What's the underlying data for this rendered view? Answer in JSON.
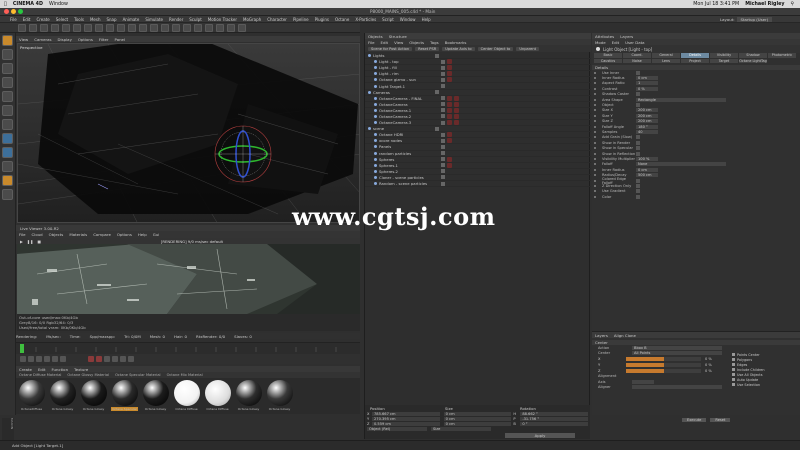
{
  "mac": {
    "app": "CINEMA 4D",
    "menu": "Window",
    "clock": "Mon Jul 18  3:41 PM",
    "user": "Michael Rigley"
  },
  "window": {
    "title": "P8000_MAINS_005.c4d * - Main"
  },
  "menus": [
    "File",
    "Edit",
    "Create",
    "Select",
    "Tools",
    "Mesh",
    "Snap",
    "Animate",
    "Simulate",
    "Render",
    "Sculpt",
    "Motion Tracker",
    "MoGraph",
    "Character",
    "Pipeline",
    "Plugins",
    "Octane",
    "X-Particles",
    "Script",
    "Window",
    "Help"
  ],
  "layout": {
    "label": "Layout:",
    "value": "Startup (User)"
  },
  "viewport": {
    "menu": [
      "View",
      "Cameras",
      "Display",
      "Options",
      "Filter",
      "Panel"
    ],
    "label": "Perspective"
  },
  "liveviewer": {
    "title": "Live Viewer 3.00-R2",
    "menu": [
      "File",
      "Cloud",
      "Objects",
      "Materials",
      "Compare",
      "Options",
      "Help",
      "Gui"
    ],
    "status": "[RENDERING] 9/0 ms/sec default",
    "info1": "Out-of-core used/max:0Kb/4Gb",
    "info2": "Grey8/16: 0/0          Rgb32/64: 0/3",
    "info3": "Used/free/total vram: 0Kb/0Kb/4Gb"
  },
  "render_status": [
    "Rendering:",
    "Ms/sec:",
    "Time:",
    "Spp/maxspp:",
    "Tri: 0/0M",
    "Mesh: 0",
    "Hair: 0",
    "RtxRender: 0/0",
    "Slaves: 0"
  ],
  "materials": {
    "menu": [
      "Create",
      "Edit",
      "Function",
      "Texture"
    ],
    "tabs": [
      "Octane Diffuse Material",
      "Octane Glossy Material",
      "Octane Specular Material",
      "Octane Mix Material"
    ],
    "items": [
      {
        "label": "OctaneDiffuse",
        "fill": "#3a3a3a"
      },
      {
        "label": "Octane Glossy",
        "fill": "#222222"
      },
      {
        "label": "Octane Glossy",
        "fill": "#1a1a1a"
      },
      {
        "label": "Octane Specular",
        "fill": "#2a2a2a"
      },
      {
        "label": "Octane Glossy",
        "fill": "#1c1c1c"
      },
      {
        "label": "Octane Diffuse",
        "fill": "#f2f2f2"
      },
      {
        "label": "Octane Diffuse",
        "fill": "#dddddd"
      },
      {
        "label": "Octane Glossy",
        "fill": "#2e2e2e"
      },
      {
        "label": "Octane Glossy",
        "fill": "#3a3a3a"
      }
    ]
  },
  "object_manager": {
    "tabs": [
      "Objects",
      "Structure"
    ],
    "menu": [
      "File",
      "Edit",
      "View",
      "Objects",
      "Tags",
      "Bookmarks"
    ],
    "buttons": [
      "Scene for Post Action",
      "Reset PSR",
      "Update Axis to",
      "Center Object to",
      "Unparent"
    ],
    "rows": [
      {
        "name": "Lights",
        "sel": false,
        "tags": 0
      },
      {
        "name": "Light - top",
        "sel": false,
        "tags": 1
      },
      {
        "name": "Light - fill",
        "sel": false,
        "tags": 1
      },
      {
        "name": "Light - rim",
        "sel": false,
        "tags": 1
      },
      {
        "name": "Octane gizmo - sun",
        "sel": false,
        "tags": 1
      },
      {
        "name": "Light Target.1",
        "sel": false,
        "tags": 0
      },
      {
        "name": "Cameras",
        "sel": false,
        "tags": 0
      },
      {
        "name": "OctaneCamera - FINAL",
        "sel": false,
        "tags": 2
      },
      {
        "name": "OctaneCamera",
        "sel": false,
        "tags": 2
      },
      {
        "name": "OctaneCamera.1",
        "sel": false,
        "tags": 2
      },
      {
        "name": "OctaneCamera.2",
        "sel": false,
        "tags": 2
      },
      {
        "name": "OctaneCamera.3",
        "sel": false,
        "tags": 2
      },
      {
        "name": "scene",
        "sel": false,
        "tags": 0
      },
      {
        "name": "Octane HDRI",
        "sel": false,
        "tags": 1
      },
      {
        "name": "xcore nodes",
        "sel": false,
        "tags": 1
      },
      {
        "name": "Panels",
        "sel": false,
        "tags": 0
      },
      {
        "name": "random particles",
        "sel": false,
        "tags": 0
      },
      {
        "name": "Spheres",
        "sel": false,
        "tags": 1
      },
      {
        "name": "Spheres.1",
        "sel": false,
        "tags": 1
      },
      {
        "name": "Spheres.2",
        "sel": false,
        "tags": 0
      },
      {
        "name": "Cloner - scene particles",
        "sel": false,
        "tags": 0
      },
      {
        "name": "Random - scene particles",
        "sel": false,
        "tags": 0
      }
    ]
  },
  "coords": {
    "headers": [
      "Position",
      "Size",
      "Rotation"
    ],
    "rows": [
      {
        "axis": "X",
        "pos": "785.667 cm",
        "size": "0 cm",
        "rot": "H",
        "rotv": "88.662 °"
      },
      {
        "axis": "Y",
        "pos": "270.395 cm",
        "size": "0 cm",
        "rot": "P",
        "rotv": "-31.756 °"
      },
      {
        "axis": "Z",
        "pos": "0.559 cm",
        "size": "0 cm",
        "rot": "B",
        "rotv": "0 °"
      }
    ],
    "mode": "Object (Rel)",
    "size_mode": "Size",
    "apply": "Apply"
  },
  "attributes": {
    "tabs": [
      "Attributes",
      "Layers"
    ],
    "menu": [
      "Mode",
      "Edit",
      "User Data"
    ],
    "title": "Light Object [Light - top]",
    "ptabs": [
      {
        "label": "Basic",
        "on": false
      },
      {
        "label": "Coord.",
        "on": false
      },
      {
        "label": "General",
        "on": false
      },
      {
        "label": "Details",
        "on": true
      },
      {
        "label": "Visibility",
        "on": false
      },
      {
        "label": "Shadow",
        "on": false
      },
      {
        "label": "Photometric",
        "on": false
      },
      {
        "label": "Caustics",
        "on": false
      },
      {
        "label": "Noise",
        "on": false
      },
      {
        "label": "Lens",
        "on": false
      },
      {
        "label": "Project",
        "on": false
      },
      {
        "label": "Target",
        "on": false
      },
      {
        "label": "Octane LightTag",
        "on": false
      }
    ],
    "section": "Details",
    "params": [
      {
        "label": "Use Inner",
        "value": ""
      },
      {
        "label": "Inner Radius",
        "value": "0 cm"
      },
      {
        "label": "Aspect Ratio",
        "value": "1"
      },
      {
        "label": "Contrast",
        "value": "0 %"
      },
      {
        "label": "Shadow Caster",
        "value": ""
      },
      {
        "label": "Area Shape",
        "value": "Rectangle"
      },
      {
        "label": "Object",
        "value": ""
      },
      {
        "label": "Size X",
        "value": "200 cm"
      },
      {
        "label": "Size Y",
        "value": "200 cm"
      },
      {
        "label": "Size Z",
        "value": "200 cm"
      },
      {
        "label": "Falloff Angle",
        "value": "180 °"
      },
      {
        "label": "Samples",
        "value": "40"
      },
      {
        "label": "Add Grain (Slow)",
        "value": ""
      },
      {
        "label": "Show in Render",
        "value": ""
      },
      {
        "label": "Show in Specular",
        "value": ""
      },
      {
        "label": "Show in Reflection",
        "value": ""
      },
      {
        "label": "Visibility Multiplier",
        "value": "100 %"
      },
      {
        "label": "Falloff",
        "value": "None"
      },
      {
        "label": "Inner Radius",
        "value": "0 cm"
      },
      {
        "label": "Radius/Decay",
        "value": "500 cm"
      },
      {
        "label": "Colored Edge Falloff",
        "value": ""
      },
      {
        "label": "Z Direction Only",
        "value": ""
      },
      {
        "label": "Use Gradient",
        "value": ""
      },
      {
        "label": "Color",
        "value": ""
      }
    ]
  },
  "aligner": {
    "tabs": [
      "Layers",
      "Align Clone"
    ],
    "section": "Center",
    "rows": [
      {
        "label": "Action",
        "value": "Bbox B"
      },
      {
        "label": "Center",
        "value": "All Points"
      }
    ],
    "sliders": [
      {
        "label": "X",
        "value": "0 %",
        "level": 0.5
      },
      {
        "label": "Y",
        "value": "0 %",
        "level": 0.5
      },
      {
        "label": "Z",
        "value": "0 %",
        "level": 0.5
      }
    ],
    "checks": [
      "Points Center",
      "Polygons",
      "Edges",
      "Include Children",
      "Use All Objects",
      "Auto Update",
      "Use Selection"
    ],
    "aligned_label": "Alignment",
    "axis_label": "Axis",
    "aligner_label": "Aligner",
    "buttons": [
      "Execute",
      "Reset"
    ]
  },
  "statusbar": {
    "text": "Add Object [Light Target.1]"
  },
  "watermark": "www.cgtsj.com",
  "colors": {
    "accent": "#6d8aa1",
    "slider": "#c67a2e"
  }
}
